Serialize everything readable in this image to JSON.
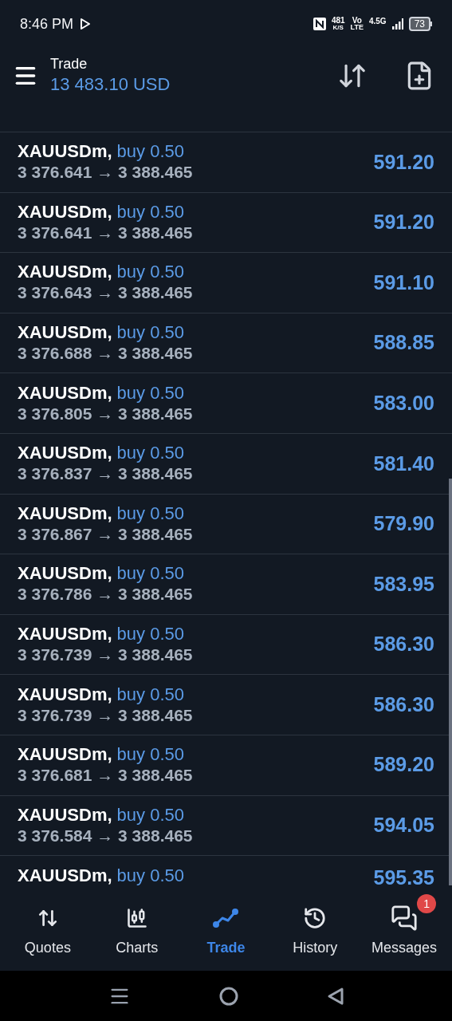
{
  "status_bar": {
    "time": "8:46 PM",
    "speed": "481",
    "speed_unit": "K/S",
    "volte_top": "Vo",
    "volte_bottom": "LTE",
    "network": "4.5G",
    "battery": "73"
  },
  "header": {
    "title": "Trade",
    "balance": "13 483.10 USD"
  },
  "positions": [
    {
      "symbol": "XAUUSDm,",
      "side": "buy 0.50",
      "route": "3 376.641 → 3 388.465",
      "profit": "591.20"
    },
    {
      "symbol": "XAUUSDm,",
      "side": "buy 0.50",
      "route": "3 376.641 → 3 388.465",
      "profit": "591.20"
    },
    {
      "symbol": "XAUUSDm,",
      "side": "buy 0.50",
      "route": "3 376.643 → 3 388.465",
      "profit": "591.10"
    },
    {
      "symbol": "XAUUSDm,",
      "side": "buy 0.50",
      "route": "3 376.688 → 3 388.465",
      "profit": "588.85"
    },
    {
      "symbol": "XAUUSDm,",
      "side": "buy 0.50",
      "route": "3 376.805 → 3 388.465",
      "profit": "583.00"
    },
    {
      "symbol": "XAUUSDm,",
      "side": "buy 0.50",
      "route": "3 376.837 → 3 388.465",
      "profit": "581.40"
    },
    {
      "symbol": "XAUUSDm,",
      "side": "buy 0.50",
      "route": "3 376.867 → 3 388.465",
      "profit": "579.90"
    },
    {
      "symbol": "XAUUSDm,",
      "side": "buy 0.50",
      "route": "3 376.786 → 3 388.465",
      "profit": "583.95"
    },
    {
      "symbol": "XAUUSDm,",
      "side": "buy 0.50",
      "route": "3 376.739 → 3 388.465",
      "profit": "586.30"
    },
    {
      "symbol": "XAUUSDm,",
      "side": "buy 0.50",
      "route": "3 376.739 → 3 388.465",
      "profit": "586.30"
    },
    {
      "symbol": "XAUUSDm,",
      "side": "buy 0.50",
      "route": "3 376.681 → 3 388.465",
      "profit": "589.20"
    },
    {
      "symbol": "XAUUSDm,",
      "side": "buy 0.50",
      "route": "3 376.584 → 3 388.465",
      "profit": "594.05"
    },
    {
      "symbol": "XAUUSDm,",
      "side": "buy 0.50",
      "profit": "595.35"
    }
  ],
  "tabs": [
    {
      "kind": "quotes",
      "label": "Quotes",
      "selected": false
    },
    {
      "kind": "charts",
      "label": "Charts",
      "selected": false
    },
    {
      "kind": "trade",
      "label": "Trade",
      "selected": true
    },
    {
      "kind": "history",
      "label": "History",
      "selected": false
    },
    {
      "kind": "messages",
      "label": "Messages",
      "selected": false,
      "badge": "1"
    }
  ]
}
